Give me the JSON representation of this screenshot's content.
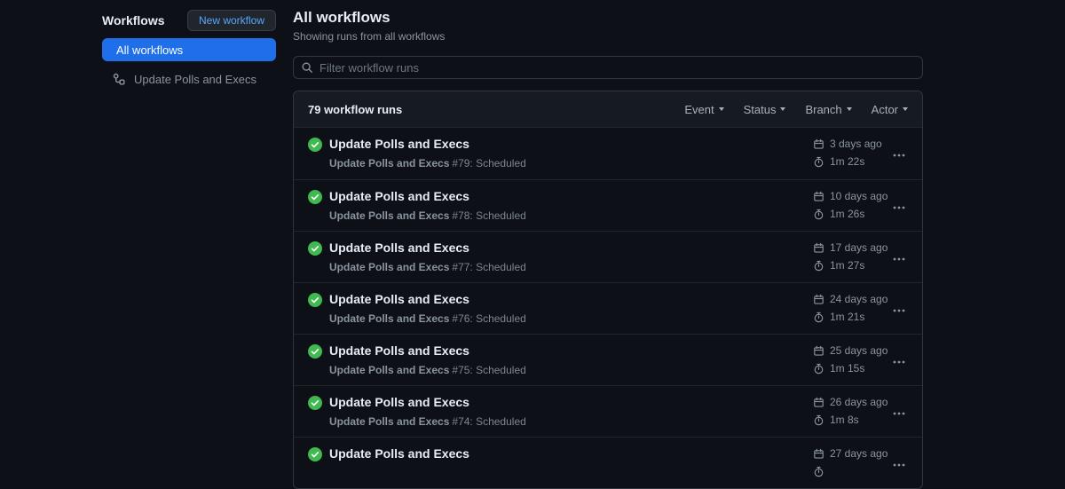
{
  "colors": {
    "background": "#0d1117",
    "surface": "#161b22",
    "border": "#30363d",
    "accent_blue": "#1f6feb",
    "link_blue": "#58a6ff",
    "success_green": "#3fb950",
    "muted_text": "#8b949e"
  },
  "sidebar": {
    "title": "Workflows",
    "new_workflow_button": "New workflow",
    "items": [
      {
        "label": "All workflows",
        "selected": true
      },
      {
        "label": "Update Polls and Execs",
        "selected": false
      }
    ]
  },
  "main": {
    "title": "All workflows",
    "subtitle": "Showing runs from all workflows",
    "filter_placeholder": "Filter workflow runs"
  },
  "table": {
    "count_label": "79 workflow runs",
    "filters": [
      {
        "label": "Event"
      },
      {
        "label": "Status"
      },
      {
        "label": "Branch"
      },
      {
        "label": "Actor"
      }
    ],
    "rows": [
      {
        "status": "success",
        "title": "Update Polls and Execs",
        "run_name": "Update Polls and Execs",
        "run_meta": "#79: Scheduled",
        "date": "3 days ago",
        "duration": "1m 22s"
      },
      {
        "status": "success",
        "title": "Update Polls and Execs",
        "run_name": "Update Polls and Execs",
        "run_meta": "#78: Scheduled",
        "date": "10 days ago",
        "duration": "1m 26s"
      },
      {
        "status": "success",
        "title": "Update Polls and Execs",
        "run_name": "Update Polls and Execs",
        "run_meta": "#77: Scheduled",
        "date": "17 days ago",
        "duration": "1m 27s"
      },
      {
        "status": "success",
        "title": "Update Polls and Execs",
        "run_name": "Update Polls and Execs",
        "run_meta": "#76: Scheduled",
        "date": "24 days ago",
        "duration": "1m 21s"
      },
      {
        "status": "success",
        "title": "Update Polls and Execs",
        "run_name": "Update Polls and Execs",
        "run_meta": "#75: Scheduled",
        "date": "25 days ago",
        "duration": "1m 15s"
      },
      {
        "status": "success",
        "title": "Update Polls and Execs",
        "run_name": "Update Polls and Execs",
        "run_meta": "#74: Scheduled",
        "date": "26 days ago",
        "duration": "1m 8s"
      },
      {
        "status": "success",
        "title": "Update Polls and Execs",
        "run_name": "",
        "run_meta": "",
        "date": "27 days ago",
        "duration": ""
      }
    ]
  }
}
